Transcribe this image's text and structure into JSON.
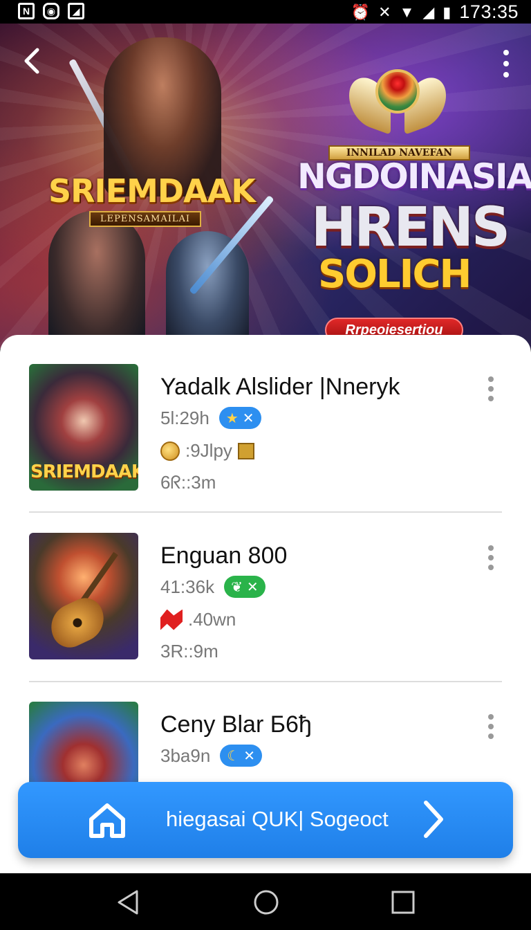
{
  "status_bar": {
    "time": "173:35",
    "left_icons": [
      "notification-n-icon",
      "notification-app-icon",
      "image-icon"
    ],
    "right_icons": [
      "alarm-icon",
      "mute-icon",
      "wifi-icon",
      "signal-icon",
      "battery-icon"
    ]
  },
  "banner": {
    "left_logo_title": "SRIEMDAAK",
    "left_logo_subtitle": "LEPENSAMAILAI",
    "right_top_ribbon": "INNILAD NAVEFAN",
    "right_title": "NGDOINASIA",
    "right_title_2": "HRENS",
    "right_title_3": "SOLICH",
    "right_button": "Rrpeoiesertiou"
  },
  "items": [
    {
      "title": "Yadalk Alslider |Nneryk",
      "meta": "5l:29h",
      "badge_icon": "star-icon",
      "badge_text": "✕",
      "line2": ":9Jlpy",
      "line3": "6ᖇ::3m",
      "thumb_logo": "SRIEMDAAK"
    },
    {
      "title": "Enguan 800",
      "meta": "41:36k",
      "badge_icon": "leaf-icon",
      "badge_text": "✕",
      "line2": ".40wn",
      "line3": "3R::9m"
    },
    {
      "title": "Ceny Blar Б6ђ",
      "meta": "3ba9n",
      "badge_icon": "moon-icon",
      "badge_text": "✕"
    }
  ],
  "cta": {
    "label": "hiegasai QUK| Sogeoct"
  },
  "colors": {
    "accent": "#2d8ff0",
    "cta": "#2a8bf5",
    "badge_green": "#2ab34a",
    "banner_button": "#d01c1c"
  }
}
